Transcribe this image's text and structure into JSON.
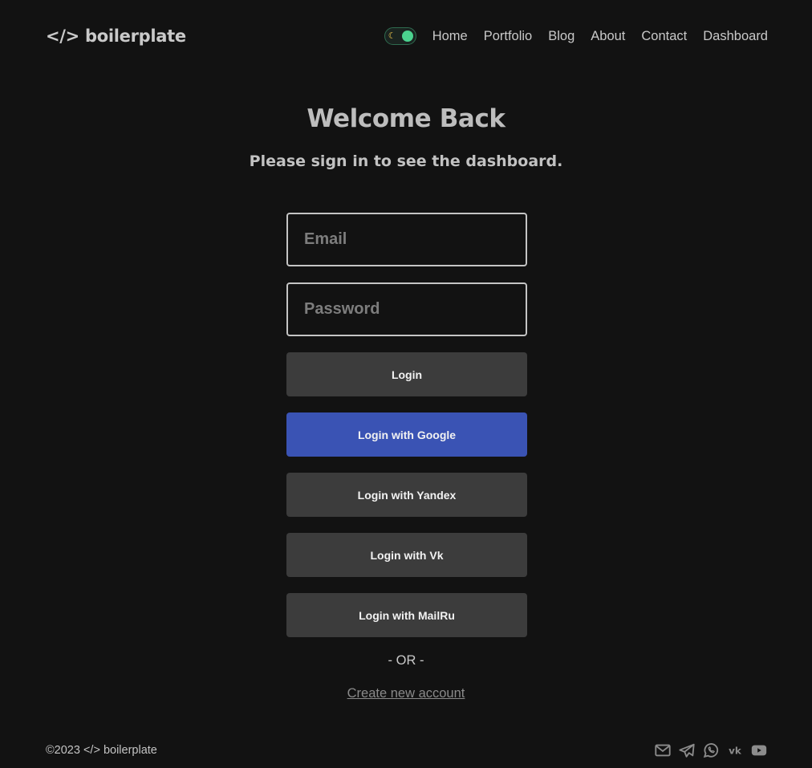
{
  "header": {
    "logo": "</> boilerplate",
    "nav": {
      "home": "Home",
      "portfolio": "Portfolio",
      "blog": "Blog",
      "about": "About",
      "contact": "Contact",
      "dashboard": "Dashboard"
    },
    "theme_toggle": {
      "icon": "moon-icon",
      "state": "dark"
    }
  },
  "main": {
    "title": "Welcome Back",
    "subtitle": "Please sign in to see the dashboard.",
    "email_placeholder": "Email",
    "password_placeholder": "Password",
    "buttons": {
      "login": "Login",
      "google": "Login with Google",
      "yandex": "Login with Yandex",
      "vk": "Login with Vk",
      "mailru": "Login with MailRu"
    },
    "or_text": "- OR -",
    "create_account": "Create new account"
  },
  "footer": {
    "copyright": "©2023 </> boilerplate",
    "socials": [
      "mail-icon",
      "telegram-icon",
      "whatsapp-icon",
      "vk-icon",
      "youtube-icon"
    ]
  },
  "colors": {
    "background": "#121212",
    "button": "#3c3c3c",
    "google_button": "#3a53b4",
    "toggle_knob": "#4bd28f",
    "text": "#c8c8c8"
  }
}
